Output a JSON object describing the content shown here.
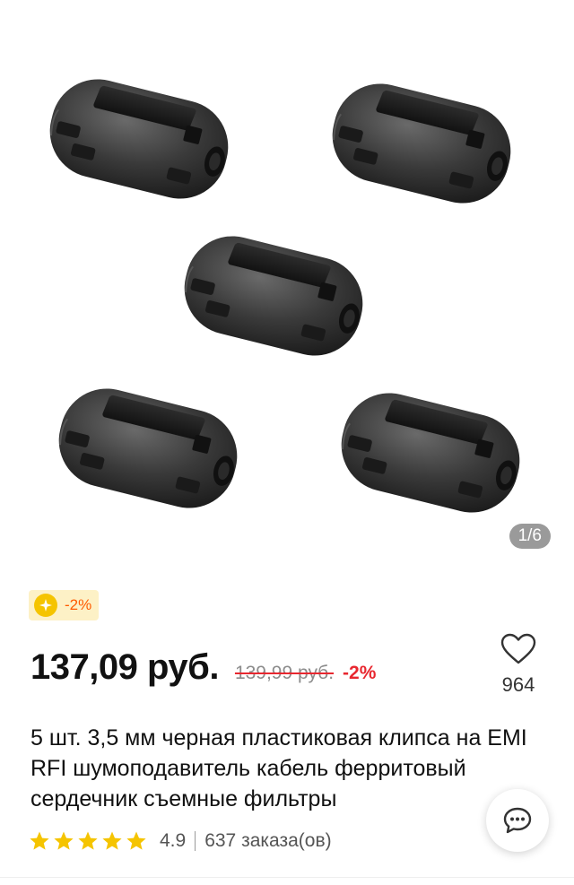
{
  "gallery": {
    "page_indicator": "1/6"
  },
  "promo": {
    "badge_text": "-2%",
    "coin_color": "#f5c400"
  },
  "price": {
    "current": "137,09 руб.",
    "original": "139,99 руб.",
    "discount": "-2%"
  },
  "wishlist": {
    "count": "964"
  },
  "product": {
    "title": "5 шт. 3,5 мм черная пластиковая клипса на EMI RFI шумоподавитель кабель ферритовый сердечник съемные фильтры"
  },
  "rating": {
    "stars": 5,
    "score": "4.9",
    "orders": "637 заказа(ов)"
  },
  "colors": {
    "accent_red": "#e8272f",
    "star_yellow": "#f5c400"
  }
}
